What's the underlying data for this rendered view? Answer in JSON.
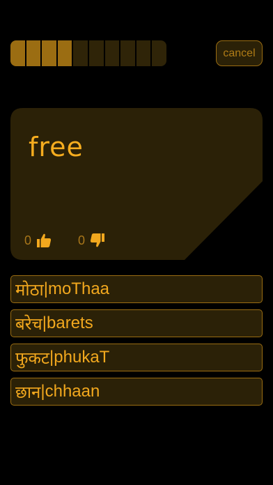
{
  "progress": {
    "total_segments": 10,
    "filled_segments": 4
  },
  "header": {
    "cancel_label": "cancel"
  },
  "card": {
    "word": "free",
    "upvotes": "0",
    "downvotes": "0"
  },
  "options": [
    {
      "devanagari": "मोठा",
      "separator": " | ",
      "transliteration": "moThaa"
    },
    {
      "devanagari": "बरेच",
      "separator": " | ",
      "transliteration": "barets"
    },
    {
      "devanagari": "फुकट",
      "separator": " | ",
      "transliteration": "phukaT"
    },
    {
      "devanagari": "छान",
      "separator": " | ",
      "transliteration": "chhaan"
    }
  ],
  "colors": {
    "background": "#000000",
    "accent": "#f2a81e",
    "card": "#2b2107",
    "progress_filled": "#9b6d12",
    "progress_empty": "#2f2408",
    "border": "#9b6d12"
  },
  "icons": {
    "upvote": "thumbs-up-icon",
    "downvote": "thumbs-down-icon"
  }
}
